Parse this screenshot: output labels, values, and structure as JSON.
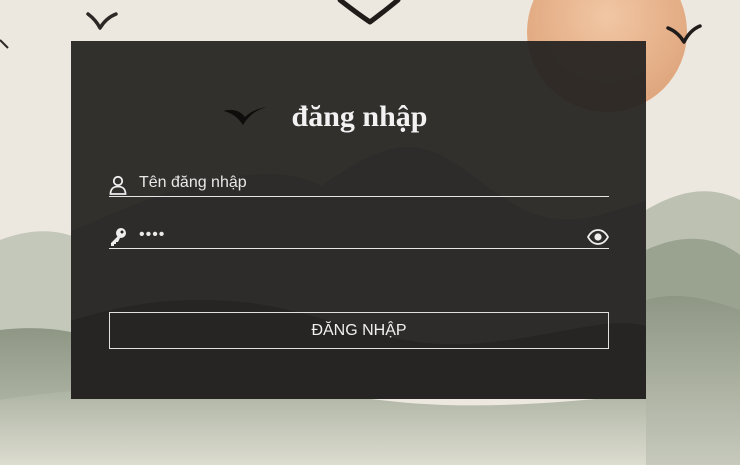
{
  "login": {
    "title": "đăng nhập",
    "username": {
      "placeholder": "Tên đăng nhập",
      "value": ""
    },
    "password": {
      "value": "••••"
    },
    "submit_label": "ĐĂNG NHẬP"
  },
  "icons": {
    "username": "user-icon",
    "password": "key-icon",
    "toggle": "eye-icon",
    "decoration": "bird-icon"
  },
  "colors": {
    "panel": "#22211f",
    "text": "#f2f2f2",
    "sun": "#e7b58f",
    "hills": "#98a08e"
  }
}
